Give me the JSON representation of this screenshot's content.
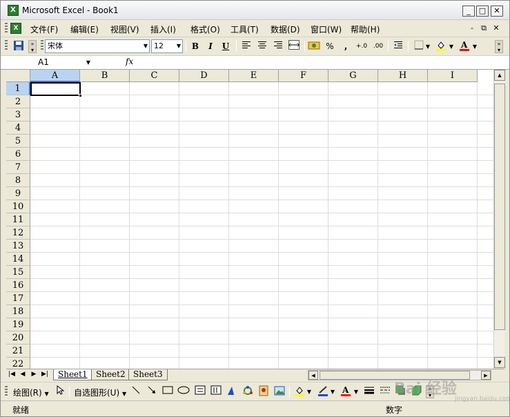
{
  "window": {
    "title": "Microsoft Excel - Book1",
    "min": "_",
    "max": "□",
    "close": "✕"
  },
  "menu": {
    "items": [
      "文件(F)",
      "编辑(E)",
      "视图(V)",
      "插入(I)",
      "格式(O)",
      "工具(T)",
      "数据(D)",
      "窗口(W)",
      "帮助(H)"
    ],
    "mdi_min": "-",
    "mdi_restore": "⧉",
    "mdi_close": "✕"
  },
  "toolbar": {
    "font": "宋体",
    "size": "12",
    "bold": "B",
    "italic": "I",
    "underline": "U",
    "percent": "%",
    "comma": ",",
    "inc_decimal": "+.0",
    "dec_decimal": ".00",
    "fill_color": "#ffff00",
    "font_color": "#ff0000"
  },
  "formula": {
    "name_box": "A1",
    "fx": "fx",
    "value": ""
  },
  "grid": {
    "columns": [
      "A",
      "B",
      "C",
      "D",
      "E",
      "F",
      "G",
      "H",
      "I"
    ],
    "rows": [
      "1",
      "2",
      "3",
      "4",
      "5",
      "6",
      "7",
      "8",
      "9",
      "10",
      "11",
      "12",
      "13",
      "14",
      "15",
      "16",
      "17",
      "18",
      "19",
      "20",
      "21",
      "22"
    ],
    "selected_column": "A",
    "selected_row": "1"
  },
  "sheets": {
    "tabs": [
      "Sheet1",
      "Sheet2",
      "Sheet3"
    ],
    "active": "Sheet1"
  },
  "drawing": {
    "draw_menu": "绘图(R)",
    "autoshapes": "自选图形(U)"
  },
  "status": {
    "left": "就绪",
    "right": "数字"
  },
  "watermark": {
    "text": "Bai 经验",
    "sub": "jingyan.baidu.com"
  }
}
